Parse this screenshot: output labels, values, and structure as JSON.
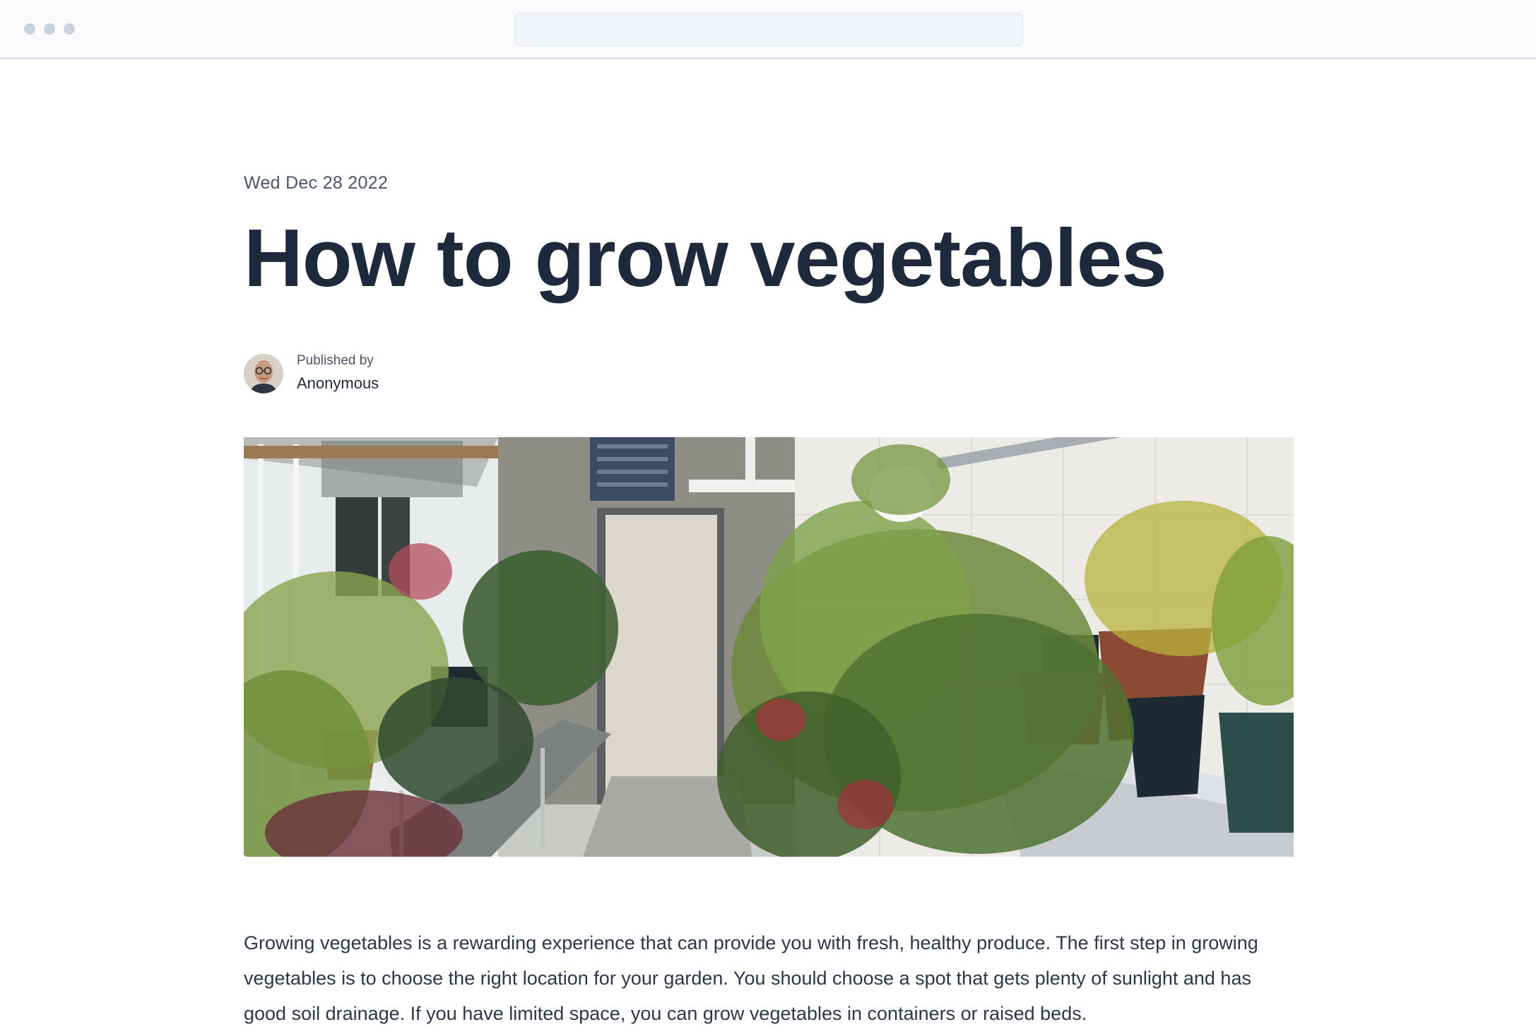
{
  "browser": {
    "window_controls": [
      "dot",
      "dot",
      "dot"
    ]
  },
  "article": {
    "date": "Wed Dec 28 2022",
    "title": "How to grow vegetables",
    "author": {
      "label": "Published by",
      "name": "Anonymous"
    },
    "hero_image": {
      "subject": "greenhouse interior with potted plants"
    },
    "body": "Growing vegetables is a rewarding experience that can provide you with fresh, healthy produce. The first step in growing vegetables is to choose the right location for your garden. You should choose a spot that gets plenty of sunlight and has good soil drainage. If you have limited space, you can grow vegetables in containers or raised beds."
  },
  "colors": {
    "title": "#1e293b",
    "body_text": "#2d3748",
    "muted_text": "#4a5568",
    "chrome_bg": "#fbfbfd",
    "address_bar_bg": "#f1f4f8"
  }
}
